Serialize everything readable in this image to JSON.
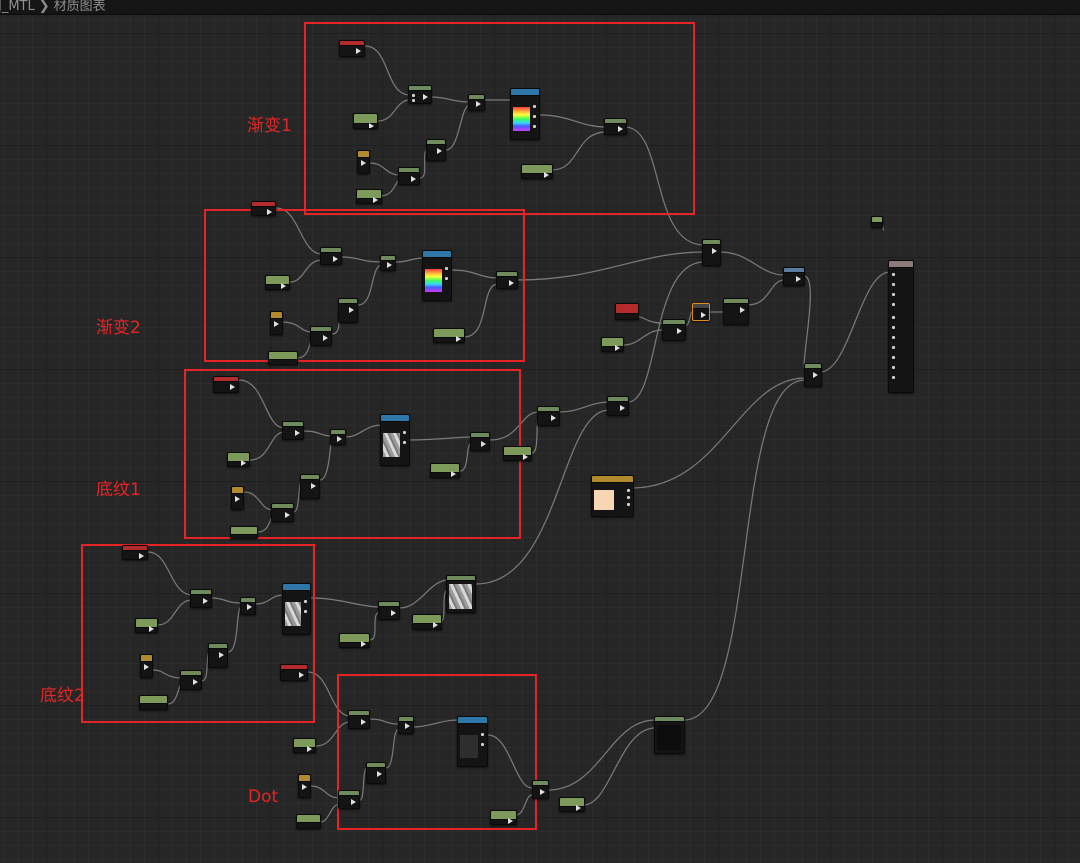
{
  "breadcrumb": {
    "asset": "J_MTL",
    "separator": "❯",
    "graph": "材质图表"
  },
  "groups": [
    {
      "id": "gradient1",
      "label": "渐变1"
    },
    {
      "id": "gradient2",
      "label": "渐变2"
    },
    {
      "id": "base1",
      "label": "底纹1"
    },
    {
      "id": "base2",
      "label": "底纹2"
    },
    {
      "id": "dot",
      "label": "Dot"
    }
  ],
  "colors": {
    "group_outline": "#e52525",
    "wire": "#8a8a8a",
    "grid_bg": "#262626"
  }
}
